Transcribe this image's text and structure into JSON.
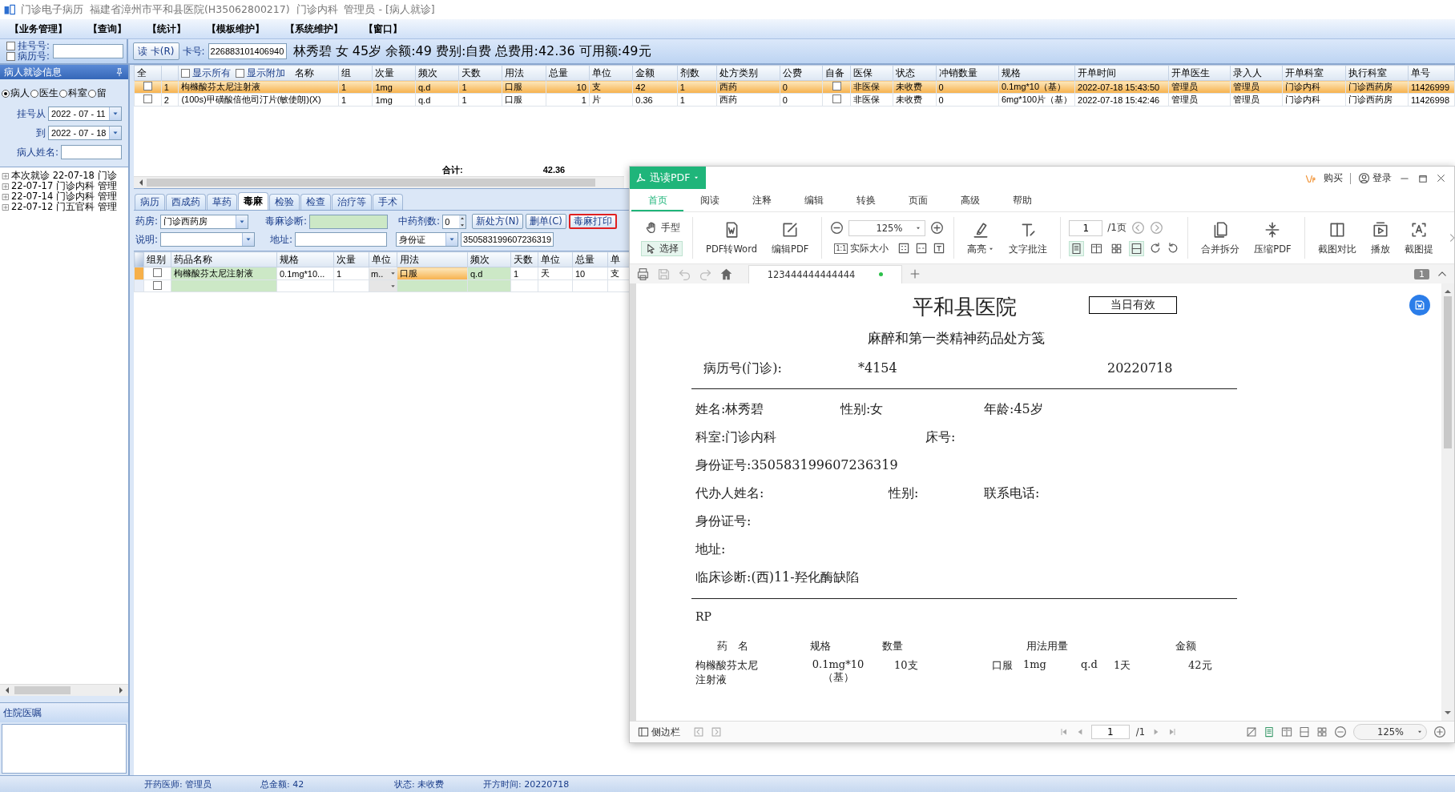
{
  "window": {
    "title": "门诊电子病历  福建省漳州市平和县医院(H35062800217)  门诊内科  管理员 - [病人就诊]"
  },
  "menu": [
    "【业务管理】",
    "【查询】",
    "【统计】",
    "【模板维护】",
    "【系统维护】",
    "【窗口】"
  ],
  "patient_bar": {
    "lookup": [
      {
        "label": "挂号号:",
        "checked": false
      },
      {
        "label": "病历号:",
        "checked": false
      }
    ],
    "read_card": "读 卡(R)",
    "card_label": "卡号:",
    "card_number": "226883101406940",
    "summary": "林秀碧 女 45岁 余额:49 费别:自费 总费用:42.36 可用额:49元"
  },
  "sidebar": {
    "title": "病人就诊信息",
    "filters": [
      {
        "label": "病人",
        "selected": true
      },
      {
        "label": "医生",
        "selected": false
      },
      {
        "label": "科室",
        "selected": false
      },
      {
        "label": "留",
        "selected": false
      }
    ],
    "date_from_label": "挂号从",
    "date_from": "2022 - 07 - 11",
    "date_to_label": "到",
    "date_to": "2022 - 07 - 18",
    "name_label": "病人姓名:",
    "visits": [
      {
        "text": "本次就诊 22-07-18 门诊",
        "expanded": false
      },
      {
        "text": "22-07-17 门诊内科 管理",
        "expanded": false
      },
      {
        "text": "22-07-14 门诊内科 管理",
        "expanded": false
      },
      {
        "text": "22-07-12 门五官科 管理",
        "expanded": false
      }
    ],
    "orders_title": "住院医嘱"
  },
  "orders_table": {
    "select_all": "全",
    "toggles": [
      {
        "label": "显示所有",
        "checked": false
      },
      {
        "label": "显示附加",
        "checked": false
      }
    ],
    "columns": [
      {
        "label": "名称",
        "kind": "text"
      },
      {
        "label": "组",
        "kind": "text"
      },
      {
        "label": "次量",
        "kind": "text"
      },
      {
        "label": "频次",
        "kind": "text"
      },
      {
        "label": "天数",
        "kind": "text"
      },
      {
        "label": "用法",
        "kind": "text"
      },
      {
        "label": "总量",
        "kind": "text"
      },
      {
        "label": "单位",
        "kind": "text"
      },
      {
        "label": "金额",
        "kind": "text"
      },
      {
        "label": "剂数",
        "kind": "text"
      },
      {
        "label": "处方类别",
        "kind": "text"
      },
      {
        "label": "公费",
        "kind": "text"
      },
      {
        "label": "自备",
        "kind": "check"
      },
      {
        "label": "医保",
        "kind": "text"
      },
      {
        "label": "状态",
        "kind": "text"
      },
      {
        "label": "冲销数量",
        "kind": "text"
      },
      {
        "label": "规格",
        "kind": "text"
      },
      {
        "label": "开单时间",
        "kind": "text"
      },
      {
        "label": "开单医生",
        "kind": "text"
      },
      {
        "label": "录入人",
        "kind": "text"
      },
      {
        "label": "开单科室",
        "kind": "text"
      },
      {
        "label": "执行科室",
        "kind": "text"
      },
      {
        "label": "单号",
        "kind": "text"
      }
    ],
    "rows": [
      {
        "no": "1",
        "selected": true,
        "checked": false,
        "self_supplied": false,
        "cells": [
          "枸橼酸芬太尼注射液",
          "1",
          "1mg",
          "q.d",
          "1",
          "口服",
          "10",
          "支",
          "42",
          "1",
          "西药",
          "0",
          "",
          "非医保",
          "未收费",
          "0",
          "0.1mg*10（基）",
          "2022-07-18 15:43:50",
          "管理员",
          "管理员",
          "门诊内科",
          "门诊西药房",
          "11426999"
        ]
      },
      {
        "no": "2",
        "selected": false,
        "checked": false,
        "self_supplied": false,
        "cells": [
          "(100s)甲磺酸倍他司汀片(敏使朗)(X)",
          "1",
          "1mg",
          "q.d",
          "1",
          "口服",
          "1",
          "片",
          "0.36",
          "1",
          "西药",
          "0",
          "",
          "非医保",
          "未收费",
          "0",
          "6mg*100片（基）",
          "2022-07-18 15:42:46",
          "管理员",
          "管理员",
          "门诊内科",
          "门诊西药房",
          "11426998"
        ]
      }
    ],
    "total_label": "合计:",
    "total_value": "42.36"
  },
  "prescription_tabs": [
    {
      "label": "病历",
      "selected": false
    },
    {
      "label": "西成药",
      "selected": false
    },
    {
      "label": "草药",
      "selected": false
    },
    {
      "label": "毒麻",
      "selected": true
    },
    {
      "label": "检验",
      "selected": false
    },
    {
      "label": "检查",
      "selected": false
    },
    {
      "label": "治疗等",
      "selected": false
    },
    {
      "label": "手术",
      "selected": false
    }
  ],
  "prescription_form": {
    "pharmacy_label": "药房:",
    "pharmacy": "门诊西药房",
    "diagnosis_label": "毒麻诊断:",
    "herb_doses_label": "中药剂数:",
    "herb_doses": "0",
    "buttons": [
      {
        "label": "新处方(N)",
        "highlighted": false
      },
      {
        "label": "删单(C)",
        "highlighted": false
      },
      {
        "label": "毒麻打印",
        "highlighted": true
      }
    ],
    "note_label": "说明:",
    "address_label": "地址:",
    "id_type": "身份证",
    "id_number": "350583199607236319"
  },
  "drug_table": {
    "columns": [
      "组别",
      "药品名称",
      "规格",
      "次量",
      "单位",
      "用法",
      "频次",
      "天数",
      "单位",
      "总量",
      "单"
    ],
    "rows": [
      {
        "current": true,
        "checked": false,
        "cells": [
          "枸橼酸芬太尼注射液",
          "0.1mg*10...",
          "1",
          "m..",
          "口服",
          "q.d",
          "1",
          "天",
          "10",
          "支"
        ]
      },
      {
        "current": false,
        "checked": false
      }
    ]
  },
  "status_bar": [
    "开药医师: 管理员",
    "总金额: 42",
    "状态: 未收费",
    "开方时间: 20220718"
  ],
  "pdf_viewer": {
    "app_button": "迅读PDF",
    "buy": "购买",
    "login": "登录",
    "tabs": [
      {
        "label": "首页",
        "selected": true
      },
      {
        "label": "阅读",
        "selected": false
      },
      {
        "label": "注释",
        "selected": false
      },
      {
        "label": "编辑",
        "selected": false
      },
      {
        "label": "转换",
        "selected": false
      },
      {
        "label": "页面",
        "selected": false
      },
      {
        "label": "高级",
        "selected": false
      },
      {
        "label": "帮助",
        "selected": false
      }
    ],
    "tools": {
      "hand": "手型",
      "select": "选择",
      "select_active": true,
      "to_word": "PDF转Word",
      "edit_pdf": "编辑PDF",
      "zoom": "125%",
      "actual_icon": "1:1",
      "actual_size": "实际大小",
      "highlight": "高亮",
      "text_note": "文字批注",
      "page": "1",
      "page_total": "/1页",
      "view_modes": [
        {
          "selected": true
        },
        {
          "selected": false
        },
        {
          "selected": false
        },
        {
          "selected": true
        }
      ],
      "merge": "合并拆分",
      "compress": "压缩PDF",
      "compare": "截图对比",
      "play": "播放",
      "extract": "截图提"
    },
    "doc_tab": {
      "title": "123444444444444",
      "modified": true
    },
    "page_badge": "1",
    "document": {
      "hospital": "平和县医院",
      "validity": "当日有效",
      "form_title": "麻醉和第一类精神药品处方笺",
      "record_label": "病历号(门诊):",
      "record_no": "*4154",
      "date": "20220718",
      "fields": [
        [
          "姓名:林秀碧",
          "性别:女",
          "年龄:45岁"
        ],
        [
          "科室:门诊内科",
          "床号:"
        ],
        [
          "身份证号:350583199607236319"
        ],
        [
          "代办人姓名:",
          "性别:",
          "联系电话:"
        ],
        [
          "身份证号:"
        ],
        [
          "地址:"
        ],
        [
          "临床诊断:(西)11-羟化酶缺陷"
        ]
      ],
      "rp": "RP",
      "columns": [
        "药　名",
        "规格",
        "数量",
        "用法用量",
        "金额"
      ],
      "items": [
        {
          "name": "枸橼酸芬太尼注射液",
          "spec": "0.1mg*10（基）",
          "quantity": "10支",
          "route": "口服",
          "dose": "1mg",
          "frequency": "q.d",
          "days": "1天",
          "amount": "42元"
        }
      ]
    },
    "footer": {
      "sidebar": "侧边栏",
      "page": "1",
      "page_total": "/1",
      "zoom": "125%"
    }
  }
}
